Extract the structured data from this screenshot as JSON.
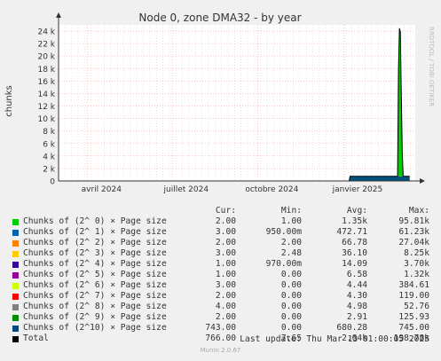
{
  "chart_data": {
    "type": "area",
    "title": "Node 0, zone DMA32 - by year",
    "ylabel": "chunks",
    "ylim": [
      0,
      25000
    ],
    "y_ticks": [
      "0",
      "2 k",
      "4 k",
      "6 k",
      "8 k",
      "10 k",
      "12 k",
      "14 k",
      "16 k",
      "18 k",
      "20 k",
      "22 k",
      "24 k"
    ],
    "y_tick_values": [
      0,
      2000,
      4000,
      6000,
      8000,
      10000,
      12000,
      14000,
      16000,
      18000,
      20000,
      22000,
      24000
    ],
    "x_ticks": [
      "avril 2024",
      "juillet 2024",
      "octobre 2024",
      "janvier 2025"
    ],
    "x_tick_dates": [
      "2024-04-01",
      "2024-07-01",
      "2024-10-01",
      "2025-01-01"
    ],
    "x_range": [
      "2024-03-01",
      "2025-03-19"
    ],
    "grid": true,
    "watermark": "RRDTOOL / TOBI OETIKER",
    "series_order_bottom_to_top": [
      "Chunks of (2^10) × Page size",
      "Chunks of (2^ 0) × Page size",
      "Chunks of (2^ 1) × Page size"
    ],
    "series": [
      {
        "name": "Chunks of (2^10) × Page size",
        "color": "#00537f",
        "points": [
          [
            "2025-01-07",
            0
          ],
          [
            "2025-01-08",
            743
          ],
          [
            "2025-02-28",
            743
          ],
          [
            "2025-03-02",
            745
          ],
          [
            "2025-03-10",
            745
          ],
          [
            "2025-03-13",
            743
          ]
        ]
      },
      {
        "name": "Chunks of (2^ 0) × Page size",
        "color": "#00cc00",
        "points": [
          [
            "2025-02-28",
            0
          ],
          [
            "2025-03-01",
            17000
          ],
          [
            "2025-03-02",
            23000
          ],
          [
            "2025-03-03",
            22500
          ],
          [
            "2025-03-05",
            4000
          ],
          [
            "2025-03-06",
            0
          ]
        ]
      },
      {
        "name": "Chunks of (2^ 1) × Page size",
        "color": "#0066b3",
        "points": [
          [
            "2025-03-01",
            0
          ],
          [
            "2025-03-02",
            700
          ],
          [
            "2025-03-03",
            600
          ],
          [
            "2025-03-04",
            0
          ]
        ]
      }
    ],
    "total_color": "#000000"
  },
  "legend": {
    "headers": {
      "cur": "Cur:",
      "min": "Min:",
      "avg": "Avg:",
      "max": "Max:"
    },
    "rows": [
      {
        "name": "Chunks of (2^ 0) × Page size",
        "color": "#00cc00",
        "cur": "2.00",
        "min": "1.00",
        "avg": "1.35k",
        "max": "95.81k"
      },
      {
        "name": "Chunks of (2^ 1) × Page size",
        "color": "#0066b3",
        "cur": "3.00",
        "min": "950.00m",
        "avg": "472.71",
        "max": "61.23k"
      },
      {
        "name": "Chunks of (2^ 2) × Page size",
        "color": "#ff8000",
        "cur": "2.00",
        "min": "2.00",
        "avg": "66.78",
        "max": "27.04k"
      },
      {
        "name": "Chunks of (2^ 3) × Page size",
        "color": "#ffcc00",
        "cur": "3.00",
        "min": "2.48",
        "avg": "36.10",
        "max": "8.25k"
      },
      {
        "name": "Chunks of (2^ 4) × Page size",
        "color": "#330099",
        "cur": "1.00",
        "min": "970.00m",
        "avg": "14.09",
        "max": "3.70k"
      },
      {
        "name": "Chunks of (2^ 5) × Page size",
        "color": "#990099",
        "cur": "1.00",
        "min": "0.00",
        "avg": "6.58",
        "max": "1.32k"
      },
      {
        "name": "Chunks of (2^ 6) × Page size",
        "color": "#ccff00",
        "cur": "3.00",
        "min": "0.00",
        "avg": "4.44",
        "max": "384.61"
      },
      {
        "name": "Chunks of (2^ 7) × Page size",
        "color": "#ff0000",
        "cur": "2.00",
        "min": "0.00",
        "avg": "4.30",
        "max": "119.00"
      },
      {
        "name": "Chunks of (2^ 8) × Page size",
        "color": "#808080",
        "cur": "4.00",
        "min": "0.00",
        "avg": "4.98",
        "max": "52.76"
      },
      {
        "name": "Chunks of (2^ 9) × Page size",
        "color": "#008f00",
        "cur": "2.00",
        "min": "0.00",
        "avg": "2.91",
        "max": "125.93"
      },
      {
        "name": "Chunks of (2^10) × Page size",
        "color": "#00487d",
        "cur": "743.00",
        "min": "0.00",
        "avg": "680.28",
        "max": "745.00"
      },
      {
        "name": "Total",
        "color": "#000000",
        "cur": "766.00",
        "min": "7.65",
        "avg": "2.64k",
        "max": "198.78k"
      }
    ]
  },
  "footer": {
    "last_update": "Last update: Thu Mar 13 01:00:05 2025",
    "version": "Munin 2.0.67"
  }
}
